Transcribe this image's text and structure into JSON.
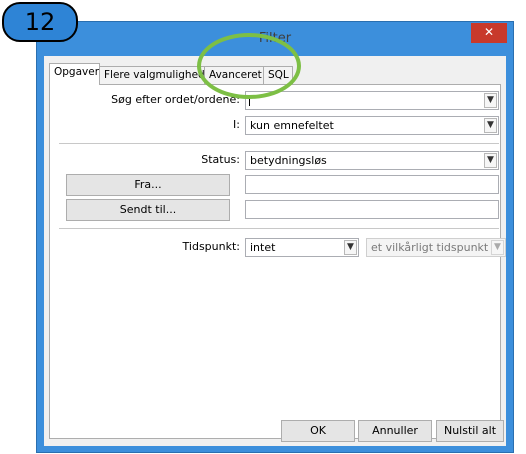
{
  "step_badge": "12",
  "window": {
    "title": "Filter",
    "close_glyph": "✕"
  },
  "tabs": [
    {
      "label": "Opgaver"
    },
    {
      "label": "Flere valgmuligheder"
    },
    {
      "label": "Avanceret"
    },
    {
      "label": "SQL"
    }
  ],
  "form": {
    "search_label": "Søg efter ordet/ordene:",
    "search_value": "",
    "in_label": "I:",
    "in_value": "kun emnefeltet",
    "status_label": "Status:",
    "status_value": "betydningsløs",
    "from_button": "Fra...",
    "from_value": "",
    "sent_to_button": "Sendt til...",
    "sent_to_value": "",
    "time_label": "Tidspunkt:",
    "time_value": "intet",
    "time_range_value": "et vilkårligt tidspunkt"
  },
  "footer": {
    "ok": "OK",
    "cancel": "Annuller",
    "reset": "Nulstil alt"
  },
  "colors": {
    "title_bar": "#3c8fdc",
    "close": "#c8392b",
    "highlight": "#7dbf45",
    "badge": "#2e84d6"
  },
  "icons": {
    "dropdown": "chevron-down-icon",
    "close": "close-icon"
  }
}
